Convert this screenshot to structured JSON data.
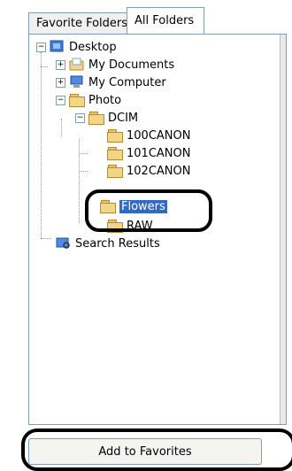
{
  "tabs": {
    "favorite": "Favorite Folders",
    "all": "All Folders"
  },
  "tree": {
    "desktop": "Desktop",
    "my_documents": "My Documents",
    "my_computer": "My Computer",
    "photo": "Photo",
    "dcim": "DCIM",
    "c100": "100CANON",
    "c101": "101CANON",
    "c102": "102CANON",
    "flowers": "Flowers",
    "raw": "RAW",
    "search_results": "Search Results"
  },
  "buttons": {
    "add_to_favorites": "Add to Favorites"
  },
  "colors": {
    "selection": "#316ac5",
    "border": "#7f9db9"
  }
}
